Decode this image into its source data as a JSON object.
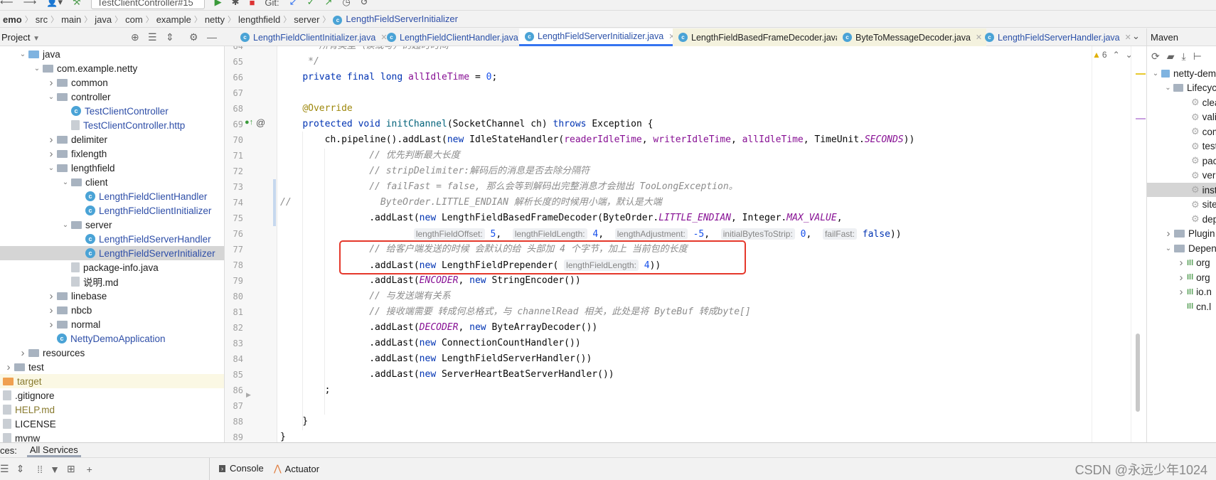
{
  "toolbar": {
    "run_config": "TestClientController#15",
    "git_label": "Git:"
  },
  "breadcrumb": [
    "emo",
    "src",
    "main",
    "java",
    "com",
    "example",
    "netty",
    "lengthfield",
    "server"
  ],
  "breadcrumb_file": "LengthFieldServerInitializer",
  "project_panel": {
    "title": "Project"
  },
  "tabs": [
    {
      "label": "LengthFieldClientInitializer.java",
      "style": "normal"
    },
    {
      "label": "LengthFieldClientHandler.java",
      "style": "normal"
    },
    {
      "label": "LengthFieldServerInitializer.java",
      "style": "active"
    },
    {
      "label": "LengthFieldBasedFrameDecoder.java",
      "style": "yellow"
    },
    {
      "label": "ByteToMessageDecoder.java",
      "style": "yellow"
    },
    {
      "label": "LengthFieldServerHandler.java",
      "style": "normal"
    }
  ],
  "tree": [
    {
      "label": "java",
      "level": 1,
      "state": "expanded",
      "icon": "folder-blue"
    },
    {
      "label": "com.example.netty",
      "level": 2,
      "state": "expanded",
      "icon": "folder"
    },
    {
      "label": "common",
      "level": 3,
      "state": "collapsed",
      "icon": "folder"
    },
    {
      "label": "controller",
      "level": 3,
      "state": "expanded",
      "icon": "folder"
    },
    {
      "label": "TestClientController",
      "level": 4,
      "state": "leaf",
      "icon": "class",
      "color": "blue"
    },
    {
      "label": "TestClientController.http",
      "level": 4,
      "state": "leaf",
      "icon": "file",
      "color": "blue"
    },
    {
      "label": "delimiter",
      "level": 3,
      "state": "collapsed",
      "icon": "folder"
    },
    {
      "label": "fixlength",
      "level": 3,
      "state": "collapsed",
      "icon": "folder"
    },
    {
      "label": "lengthfield",
      "level": 3,
      "state": "expanded",
      "icon": "folder"
    },
    {
      "label": "client",
      "level": 4,
      "state": "expanded",
      "icon": "folder"
    },
    {
      "label": "LengthFieldClientHandler",
      "level": 5,
      "state": "leaf",
      "icon": "class",
      "color": "blue"
    },
    {
      "label": "LengthFieldClientInitializer",
      "level": 5,
      "state": "leaf",
      "icon": "class",
      "color": "blue"
    },
    {
      "label": "server",
      "level": 4,
      "state": "expanded",
      "icon": "folder"
    },
    {
      "label": "LengthFieldServerHandler",
      "level": 5,
      "state": "leaf",
      "icon": "class",
      "color": "blue"
    },
    {
      "label": "LengthFieldServerInitializer",
      "level": 5,
      "state": "leaf",
      "icon": "class",
      "color": "blue",
      "selected": true
    },
    {
      "label": "package-info.java",
      "level": 4,
      "state": "leaf",
      "icon": "file"
    },
    {
      "label": "说明.md",
      "level": 4,
      "state": "leaf",
      "icon": "file"
    },
    {
      "label": "linebase",
      "level": 3,
      "state": "collapsed",
      "icon": "folder"
    },
    {
      "label": "nbcb",
      "level": 3,
      "state": "collapsed",
      "icon": "folder"
    },
    {
      "label": "normal",
      "level": 3,
      "state": "collapsed",
      "icon": "folder"
    },
    {
      "label": "NettyDemoApplication",
      "level": 3,
      "state": "leaf",
      "icon": "class",
      "color": "blue"
    },
    {
      "label": "resources",
      "level": 1,
      "state": "collapsed",
      "icon": "folder"
    },
    {
      "label": "test",
      "level": 0,
      "state": "collapsed",
      "icon": "folder"
    },
    {
      "label": "target",
      "level": -1,
      "state": "leaf",
      "icon": "folder-orange",
      "color": "olive",
      "highlight": true
    },
    {
      "label": ".gitignore",
      "level": -1,
      "state": "leaf",
      "icon": "file"
    },
    {
      "label": "HELP.md",
      "level": -1,
      "state": "leaf",
      "icon": "file",
      "color": "olive"
    },
    {
      "label": "LICENSE",
      "level": -1,
      "state": "leaf",
      "icon": "file"
    },
    {
      "label": "mvnw",
      "level": -1,
      "state": "leaf",
      "icon": "file"
    }
  ],
  "editor": {
    "warnings": "6",
    "first_line": 64,
    "lines": [
      [
        [
          "     * 所有类型（读或写）的超时时间",
          "cm"
        ]
      ],
      [
        [
          "     */",
          "cm"
        ]
      ],
      [
        [
          "    ",
          "p"
        ],
        [
          "private final long ",
          "kw"
        ],
        [
          "allIdleTime",
          "fld"
        ],
        [
          " = ",
          "p"
        ],
        [
          "0",
          "num"
        ],
        [
          ";",
          "p"
        ]
      ],
      [],
      [
        [
          "    ",
          "p"
        ],
        [
          "@Override",
          "ann"
        ]
      ],
      [
        [
          "    ",
          "p"
        ],
        [
          "protected void ",
          "kw"
        ],
        [
          "initChannel",
          "fn"
        ],
        [
          "(SocketChannel ch) ",
          "p"
        ],
        [
          "throws ",
          "kw"
        ],
        [
          "Exception {",
          "p"
        ]
      ],
      [
        [
          "        ch.pipeline().addLast(",
          "p"
        ],
        [
          "new ",
          "kw"
        ],
        [
          "IdleStateHandler(",
          "p"
        ],
        [
          "readerIdleTime",
          "fld"
        ],
        [
          ", ",
          "p"
        ],
        [
          "writerIdleTime",
          "fld"
        ],
        [
          ", ",
          "p"
        ],
        [
          "allIdleTime",
          "fld"
        ],
        [
          ", TimeUnit.",
          "p"
        ],
        [
          "SECONDS",
          "sfld"
        ],
        [
          "))",
          "p"
        ]
      ],
      [
        [
          "                // 优先判断最大长度",
          "cm"
        ]
      ],
      [
        [
          "                // stripDelimiter:解码后的消息是否去除分隔符",
          "cm"
        ]
      ],
      [
        [
          "                // failFast = false, 那么会等到解码出完整消息才会抛出 TooLongException。",
          "cm"
        ]
      ],
      [
        [
          "//                ByteOrder.LITTLE_ENDIAN 解析长度的时候用小端，默认是大端",
          "cm"
        ]
      ],
      [
        [
          "                .addLast(",
          "p"
        ],
        [
          "new ",
          "kw"
        ],
        [
          "LengthFieldBasedFrameDecoder(ByteOrder.",
          "p"
        ],
        [
          "LITTLE_ENDIAN",
          "sfld"
        ],
        [
          ", Integer.",
          "p"
        ],
        [
          "MAX_VALUE",
          "sfld"
        ],
        [
          ",",
          "p"
        ]
      ],
      [
        [
          "                        ",
          "p"
        ],
        [
          "lengthFieldOffset:",
          "hint"
        ],
        [
          " ",
          "p"
        ],
        [
          "5",
          "num"
        ],
        [
          ",  ",
          "p"
        ],
        [
          "lengthFieldLength:",
          "hint"
        ],
        [
          " ",
          "p"
        ],
        [
          "4",
          "num"
        ],
        [
          ",  ",
          "p"
        ],
        [
          "lengthAdjustment:",
          "hint"
        ],
        [
          " ",
          "p"
        ],
        [
          "-5",
          "num"
        ],
        [
          ",  ",
          "p"
        ],
        [
          "initialBytesToStrip:",
          "hint"
        ],
        [
          " ",
          "p"
        ],
        [
          "0",
          "num"
        ],
        [
          ",  ",
          "p"
        ],
        [
          "failFast:",
          "hint"
        ],
        [
          " ",
          "p"
        ],
        [
          "false",
          "kw"
        ],
        [
          "))",
          "p"
        ]
      ],
      [
        [
          "                // 给客户端发送的时候 会默认的给 头部加 4 个字节，加上 当前包的长度",
          "cm"
        ]
      ],
      [
        [
          "                .addLast(",
          "p"
        ],
        [
          "new ",
          "kw"
        ],
        [
          "LengthFieldPrepender( ",
          "p"
        ],
        [
          "lengthFieldLength:",
          "hint"
        ],
        [
          " ",
          "p"
        ],
        [
          "4",
          "num"
        ],
        [
          "))",
          "p"
        ]
      ],
      [
        [
          "                .addLast(",
          "p"
        ],
        [
          "ENCODER",
          "sfld"
        ],
        [
          ", ",
          "p"
        ],
        [
          "new ",
          "kw"
        ],
        [
          "StringEncoder())",
          "p"
        ]
      ],
      [
        [
          "                // 与发送端有关系",
          "cm"
        ]
      ],
      [
        [
          "                // 接收端需要 转成何总格式，与 channelRead 相关，此处是将 ByteBuf 转成byte[]",
          "cm"
        ]
      ],
      [
        [
          "                .addLast(",
          "p"
        ],
        [
          "DECODER",
          "sfld"
        ],
        [
          ", ",
          "p"
        ],
        [
          "new ",
          "kw"
        ],
        [
          "ByteArrayDecoder())",
          "p"
        ]
      ],
      [
        [
          "                .addLast(",
          "p"
        ],
        [
          "new ",
          "kw"
        ],
        [
          "ConnectionCountHandler())",
          "p"
        ]
      ],
      [
        [
          "                .addLast(",
          "p"
        ],
        [
          "new ",
          "kw"
        ],
        [
          "LengthFieldServerHandler())",
          "p"
        ]
      ],
      [
        [
          "                .addLast(",
          "p"
        ],
        [
          "new ",
          "kw"
        ],
        [
          "ServerHeartBeatServerHandler())",
          "p"
        ]
      ],
      [
        [
          "        ;",
          "p"
        ]
      ],
      [],
      [
        [
          "    }",
          "p"
        ]
      ],
      [
        [
          "}",
          "p"
        ]
      ]
    ]
  },
  "maven": {
    "title": "Maven",
    "items": [
      {
        "label": "netty-dem",
        "level": 0,
        "state": "expanded",
        "icon": "module"
      },
      {
        "label": "Lifecyc",
        "level": 1,
        "state": "expanded",
        "icon": "folder"
      },
      {
        "label": "clea",
        "level": 2,
        "state": "leaf",
        "icon": "gear"
      },
      {
        "label": "vali",
        "level": 2,
        "state": "leaf",
        "icon": "gear"
      },
      {
        "label": "com",
        "level": 2,
        "state": "leaf",
        "icon": "gear"
      },
      {
        "label": "test",
        "level": 2,
        "state": "leaf",
        "icon": "gear"
      },
      {
        "label": "pac",
        "level": 2,
        "state": "leaf",
        "icon": "gear"
      },
      {
        "label": "veri",
        "level": 2,
        "state": "leaf",
        "icon": "gear"
      },
      {
        "label": "inst",
        "level": 2,
        "state": "leaf",
        "icon": "gear",
        "selected": true
      },
      {
        "label": "site",
        "level": 2,
        "state": "leaf",
        "icon": "gear"
      },
      {
        "label": "dep",
        "level": 2,
        "state": "leaf",
        "icon": "gear"
      },
      {
        "label": "Plugin",
        "level": 1,
        "state": "collapsed",
        "icon": "folder"
      },
      {
        "label": "Depen",
        "level": 1,
        "state": "expanded",
        "icon": "folder"
      },
      {
        "label": "org",
        "level": 2,
        "state": "collapsed",
        "icon": "dependency"
      },
      {
        "label": "org",
        "level": 2,
        "state": "collapsed",
        "icon": "dependency"
      },
      {
        "label": "io.n",
        "level": 2,
        "state": "collapsed",
        "icon": "dependency"
      },
      {
        "label": "cn.l",
        "level": 2,
        "state": "leaf",
        "icon": "dependency"
      }
    ]
  },
  "bottom": {
    "services_prefix": "ces:",
    "services_tab": "All Services",
    "console": "Console",
    "actuator": "Actuator",
    "watermark": "CSDN @永远少年1024"
  },
  "colors": {
    "accent": "#3574f0",
    "highlight_box": "#e5382b",
    "keyword": "#0033b3",
    "field": "#871094",
    "comment": "#8c8c8c"
  }
}
